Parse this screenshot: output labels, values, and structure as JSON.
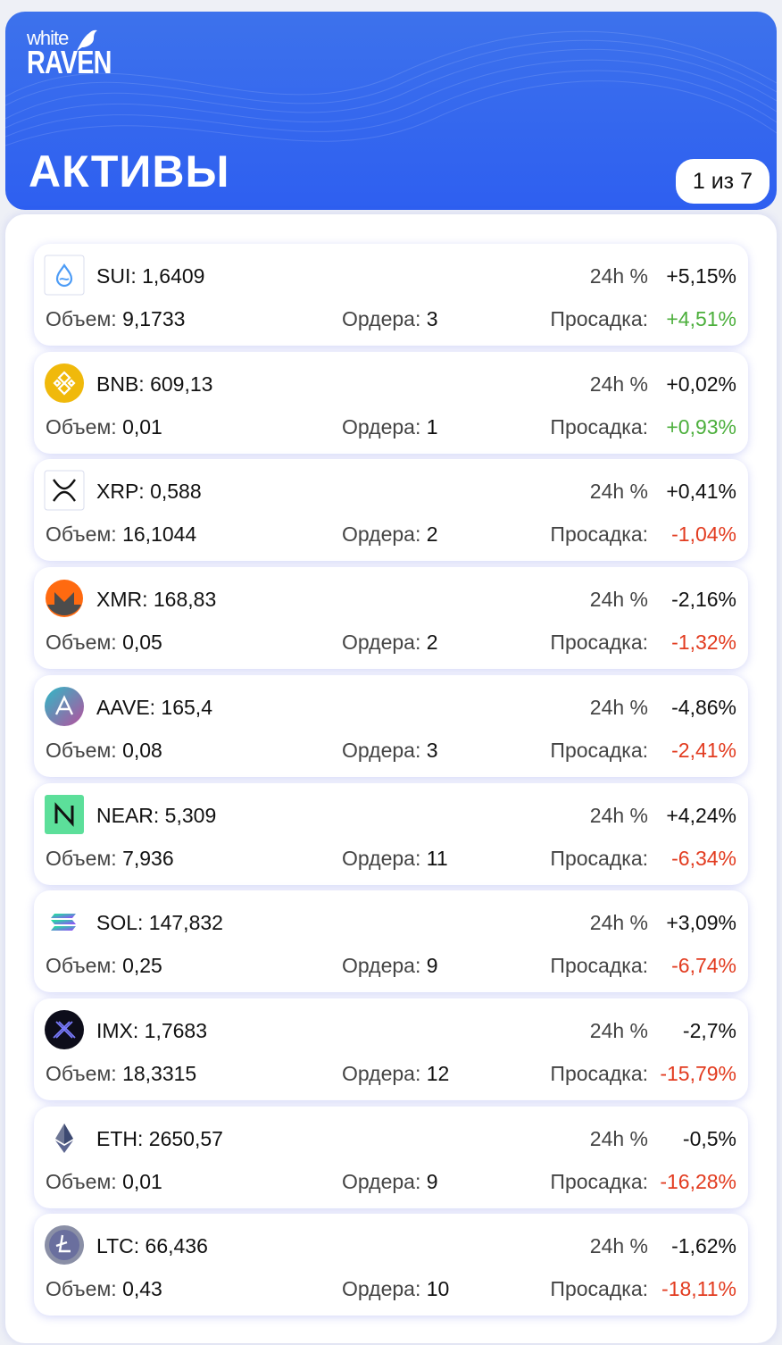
{
  "header": {
    "logo_top": "white",
    "logo_bottom": "RAVEN",
    "title": "АКТИВЫ",
    "pager": "1 из 7"
  },
  "labels": {
    "h24": "24h %",
    "volume": "Объем:",
    "orders": "Ордера:",
    "drawdown": "Просадка:"
  },
  "colors": {
    "header_blue": "#3466ee",
    "positive": "#4caf3c",
    "negative": "#e23b1f"
  },
  "assets": [
    {
      "name": "SUI: 1,6409",
      "change": "+5,15%",
      "volume": "9,1733",
      "orders": "3",
      "drawdown": "+4,51%",
      "dd_sign": "pos",
      "icon": "sui-icon"
    },
    {
      "name": "BNB: 609,13",
      "change": "+0,02%",
      "volume": "0,01",
      "orders": "1",
      "drawdown": "+0,93%",
      "dd_sign": "pos",
      "icon": "bnb-icon"
    },
    {
      "name": "XRP: 0,588",
      "change": "+0,41%",
      "volume": "16,1044",
      "orders": "2",
      "drawdown": "-1,04%",
      "dd_sign": "neg",
      "icon": "xrp-icon"
    },
    {
      "name": "XMR: 168,83",
      "change": "-2,16%",
      "volume": "0,05",
      "orders": "2",
      "drawdown": "-1,32%",
      "dd_sign": "neg",
      "icon": "xmr-icon"
    },
    {
      "name": "AAVE: 165,4",
      "change": "-4,86%",
      "volume": "0,08",
      "orders": "3",
      "drawdown": "-2,41%",
      "dd_sign": "neg",
      "icon": "aave-icon"
    },
    {
      "name": "NEAR: 5,309",
      "change": "+4,24%",
      "volume": "7,936",
      "orders": "11",
      "drawdown": "-6,34%",
      "dd_sign": "neg",
      "icon": "near-icon"
    },
    {
      "name": "SOL: 147,832",
      "change": "+3,09%",
      "volume": "0,25",
      "orders": "9",
      "drawdown": "-6,74%",
      "dd_sign": "neg",
      "icon": "sol-icon"
    },
    {
      "name": "IMX: 1,7683",
      "change": "-2,7%",
      "volume": "18,3315",
      "orders": "12",
      "drawdown": "-15,79%",
      "dd_sign": "neg",
      "icon": "imx-icon"
    },
    {
      "name": "ETH: 2650,57",
      "change": "-0,5%",
      "volume": "0,01",
      "orders": "9",
      "drawdown": "-16,28%",
      "dd_sign": "neg",
      "icon": "eth-icon"
    },
    {
      "name": "LTC: 66,436",
      "change": "-1,62%",
      "volume": "0,43",
      "orders": "10",
      "drawdown": "-18,11%",
      "dd_sign": "neg",
      "icon": "ltc-icon"
    }
  ]
}
